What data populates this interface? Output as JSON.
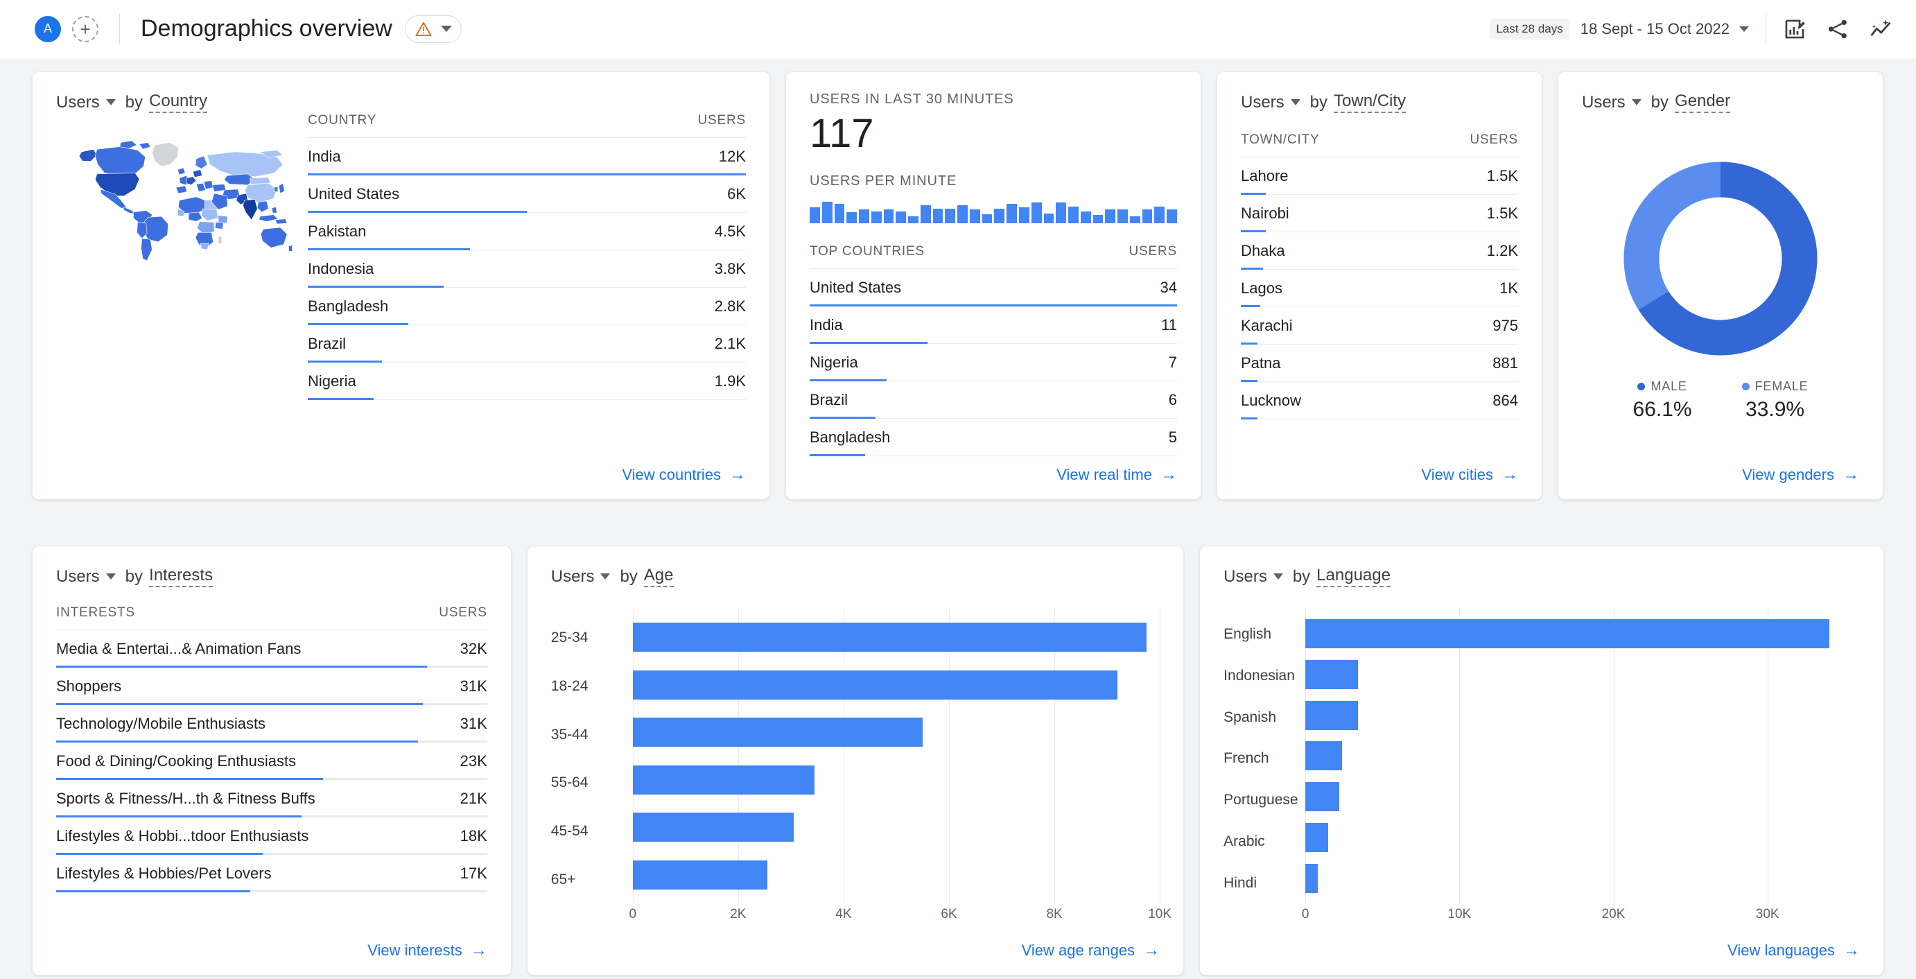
{
  "topbar": {
    "avatar_initial": "A",
    "add_label": "+",
    "page_title": "Demographics overview",
    "warning_icon": "warning-triangle-icon",
    "date_chip": "Last 28 days",
    "date_range": "18 Sept - 15 Oct 2022",
    "icons": [
      "edit-report-icon",
      "share-icon",
      "insights-icon"
    ]
  },
  "country_card": {
    "metric": "Users",
    "by": "by",
    "dimension": "Country",
    "col_dim": "COUNTRY",
    "col_users": "USERS",
    "rows": [
      {
        "name": "India",
        "value": "12K",
        "pct": 100
      },
      {
        "name": "United States",
        "value": "6K",
        "pct": 50
      },
      {
        "name": "Pakistan",
        "value": "4.5K",
        "pct": 37
      },
      {
        "name": "Indonesia",
        "value": "3.8K",
        "pct": 31
      },
      {
        "name": "Bangladesh",
        "value": "2.8K",
        "pct": 23
      },
      {
        "name": "Brazil",
        "value": "2.1K",
        "pct": 17
      },
      {
        "name": "Nigeria",
        "value": "1.9K",
        "pct": 15
      }
    ],
    "view_link": "View countries"
  },
  "realtime_card": {
    "users_caption": "USERS IN LAST 30 MINUTES",
    "users_value": "117",
    "per_minute_caption": "USERS PER MINUTE",
    "per_minute_values": [
      62,
      84,
      76,
      44,
      54,
      46,
      55,
      45,
      26,
      70,
      56,
      56,
      70,
      55,
      36,
      56,
      75,
      63,
      82,
      37,
      82,
      64,
      45,
      33,
      54,
      54,
      28,
      54,
      66,
      53
    ],
    "top_caption": "TOP COUNTRIES",
    "col_users": "USERS",
    "rows": [
      {
        "name": "United States",
        "value": "34",
        "pct": 100
      },
      {
        "name": "India",
        "value": "11",
        "pct": 32
      },
      {
        "name": "Nigeria",
        "value": "7",
        "pct": 21
      },
      {
        "name": "Brazil",
        "value": "6",
        "pct": 18
      },
      {
        "name": "Bangladesh",
        "value": "5",
        "pct": 15
      }
    ],
    "view_link": "View real time"
  },
  "city_card": {
    "metric": "Users",
    "by": "by",
    "dimension": "Town/City",
    "col_dim": "TOWN/CITY",
    "col_users": "USERS",
    "rows": [
      {
        "name": "Lahore",
        "value": "1.5K",
        "pct": 9
      },
      {
        "name": "Nairobi",
        "value": "1.5K",
        "pct": 9
      },
      {
        "name": "Dhaka",
        "value": "1.2K",
        "pct": 8
      },
      {
        "name": "Lagos",
        "value": "1K",
        "pct": 7
      },
      {
        "name": "Karachi",
        "value": "975",
        "pct": 6
      },
      {
        "name": "Patna",
        "value": "881",
        "pct": 6
      },
      {
        "name": "Lucknow",
        "value": "864",
        "pct": 6
      }
    ],
    "view_link": "View cities"
  },
  "gender_card": {
    "metric": "Users",
    "by": "by",
    "dimension": "Gender",
    "legend": [
      {
        "label": "MALE",
        "value": "66.1%",
        "color": "#3367d6"
      },
      {
        "label": "FEMALE",
        "value": "33.9%",
        "color": "#5b8def"
      }
    ],
    "view_link": "View genders"
  },
  "interests_card": {
    "metric": "Users",
    "by": "by",
    "dimension": "Interests",
    "col_dim": "INTERESTS",
    "col_users": "USERS",
    "rows": [
      {
        "name": "Media & Entertai...& Animation Fans",
        "value": "32K",
        "pct": 86
      },
      {
        "name": "Shoppers",
        "value": "31K",
        "pct": 85
      },
      {
        "name": "Technology/Mobile Enthusiasts",
        "value": "31K",
        "pct": 84
      },
      {
        "name": "Food & Dining/Cooking Enthusiasts",
        "value": "23K",
        "pct": 62
      },
      {
        "name": "Sports & Fitness/H...th & Fitness Buffs",
        "value": "21K",
        "pct": 57
      },
      {
        "name": "Lifestyles & Hobbi...tdoor Enthusiasts",
        "value": "18K",
        "pct": 48
      },
      {
        "name": "Lifestyles & Hobbies/Pet Lovers",
        "value": "17K",
        "pct": 45
      }
    ],
    "view_link": "View interests"
  },
  "age_card": {
    "metric": "Users",
    "by": "by",
    "dimension": "Age",
    "view_link": "View age ranges"
  },
  "language_card": {
    "metric": "Users",
    "by": "by",
    "dimension": "Language",
    "view_link": "View languages"
  },
  "chart_data": [
    {
      "type": "bar",
      "title": "Users by Age",
      "orientation": "horizontal",
      "categories": [
        "25-34",
        "18-24",
        "35-44",
        "55-64",
        "45-54",
        "65+"
      ],
      "values": [
        9750,
        9200,
        5500,
        3450,
        3050,
        2550
      ],
      "xlabel": "",
      "ylabel": "",
      "xlim": [
        0,
        10000
      ],
      "xticks": [
        "0",
        "2K",
        "4K",
        "6K",
        "8K",
        "10K"
      ],
      "xtick_values": [
        0,
        2000,
        4000,
        6000,
        8000,
        10000
      ],
      "grid": true,
      "color": "#4285f4"
    },
    {
      "type": "bar",
      "title": "Users by Language",
      "orientation": "horizontal",
      "categories": [
        "English",
        "Indonesian",
        "Spanish",
        "French",
        "Portuguese",
        "Arabic",
        "Hindi"
      ],
      "values": [
        34000,
        3400,
        3400,
        2400,
        2200,
        1500,
        800
      ],
      "xlabel": "",
      "ylabel": "",
      "xlim": [
        0,
        36000
      ],
      "xticks": [
        "0",
        "10K",
        "20K",
        "30K"
      ],
      "xtick_values": [
        0,
        10000,
        20000,
        30000
      ],
      "grid": true,
      "color": "#4285f4"
    },
    {
      "type": "pie",
      "title": "Users by Gender",
      "labels": [
        "MALE",
        "FEMALE"
      ],
      "values": [
        66.1,
        33.9
      ],
      "colors": [
        "#3367d6",
        "#5b8def"
      ],
      "donut": true,
      "legend": "bottom"
    },
    {
      "type": "bar",
      "title": "Users per minute",
      "categories": [
        "1",
        "2",
        "3",
        "4",
        "5",
        "6",
        "7",
        "8",
        "9",
        "10",
        "11",
        "12",
        "13",
        "14",
        "15",
        "16",
        "17",
        "18",
        "19",
        "20",
        "21",
        "22",
        "23",
        "24",
        "25",
        "26",
        "27",
        "28",
        "29",
        "30"
      ],
      "values": [
        62,
        84,
        76,
        44,
        54,
        46,
        55,
        45,
        26,
        70,
        56,
        56,
        70,
        55,
        36,
        56,
        75,
        63,
        82,
        37,
        82,
        64,
        45,
        33,
        54,
        54,
        28,
        54,
        66,
        53
      ],
      "color": "#4285f4",
      "grid": false
    }
  ]
}
